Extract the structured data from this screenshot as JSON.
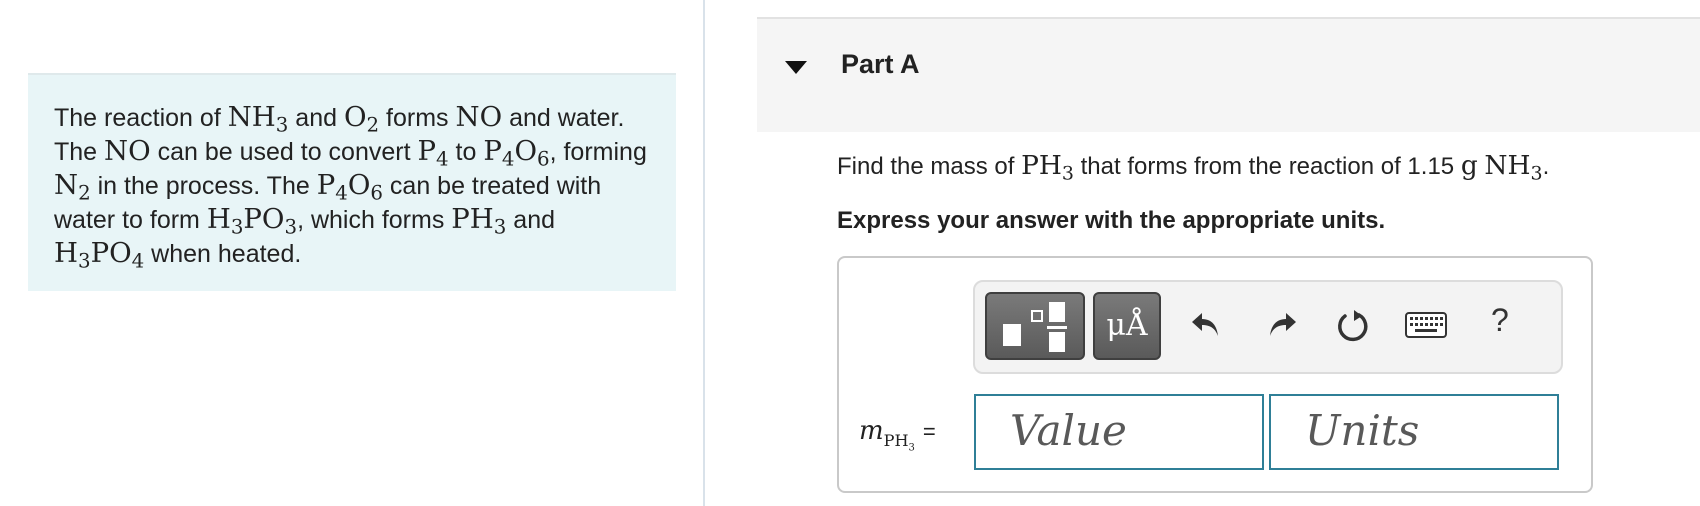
{
  "intro": {
    "parts": [
      {
        "t": "The reaction of "
      },
      {
        "m": "NH",
        "s": "3"
      },
      {
        "t": " and "
      },
      {
        "m": "O",
        "s": "2"
      },
      {
        "t": " forms "
      },
      {
        "m": "NO"
      },
      {
        "t": " and water. The "
      },
      {
        "m": "NO"
      },
      {
        "t": " can be used to convert "
      },
      {
        "m": "P",
        "s": "4"
      },
      {
        "t": " to "
      },
      {
        "m": "P",
        "s": "4"
      },
      {
        "m": "O",
        "s": "6"
      },
      {
        "t": ", forming "
      },
      {
        "m": "N",
        "s": "2"
      },
      {
        "t": " in the process. The "
      },
      {
        "m": "P",
        "s": "4"
      },
      {
        "m": "O",
        "s": "6"
      },
      {
        "t": " can be treated with water to form "
      },
      {
        "m": "H",
        "s": "3"
      },
      {
        "m": "PO",
        "s": "3"
      },
      {
        "t": ", which forms "
      },
      {
        "m": "PH",
        "s": "3"
      },
      {
        "t": " and "
      },
      {
        "m": "H",
        "s": "3"
      },
      {
        "m": "PO",
        "s": "4"
      },
      {
        "t": " when heated."
      }
    ]
  },
  "part": {
    "title": "Part A",
    "question": {
      "parts": [
        {
          "t": "Find the mass of "
        },
        {
          "m": "PH",
          "s": "3"
        },
        {
          "t": " that forms from the reaction of 1.15 "
        },
        {
          "m": "g"
        },
        {
          "t": " "
        },
        {
          "m": "NH",
          "s": "3"
        },
        {
          "t": "."
        }
      ]
    },
    "instruction": "Express your answer with the appropriate units."
  },
  "toolbar": {
    "units_button": "μÅ",
    "help_label": "?",
    "icons": [
      "templates-icon",
      "units-icon",
      "undo-icon",
      "redo-icon",
      "reset-icon",
      "keyboard-icon",
      "help-icon"
    ]
  },
  "answer": {
    "variable": "m",
    "variable_sub": "PH",
    "variable_sub_sub": "3",
    "equals": "=",
    "value_placeholder": "Value",
    "units_placeholder": "Units"
  },
  "colors": {
    "intro_bg": "#e8f5f7",
    "field_border": "#2f7f97",
    "toolbar_button": "#6a6a6a"
  }
}
